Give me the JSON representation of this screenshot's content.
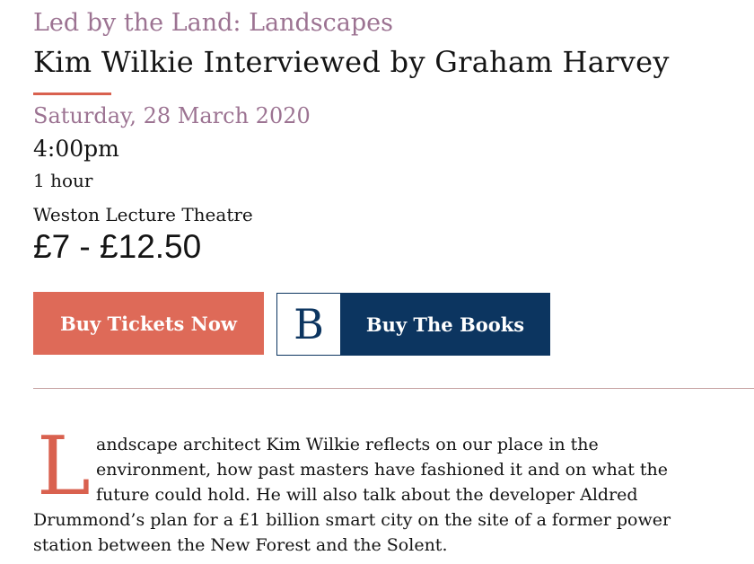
{
  "event": {
    "series": "Led by the Land: Landscapes",
    "title": "Kim Wilkie Interviewed by Graham Harvey",
    "date": "Saturday, 28 March 2020",
    "time": "4:00pm",
    "duration": "1 hour",
    "venue": "Weston Lecture Theatre",
    "price": "£7 - £12.50"
  },
  "buttons": {
    "tickets_label": "Buy Tickets Now",
    "books_logo": "B",
    "books_label": "Buy The Books"
  },
  "description": {
    "drop_cap": "L",
    "lines": [
      "andscape architect Kim Wilkie reflects on our place in the",
      "environment, how past masters have fashioned it and on what the",
      "future could hold. He will also talk about the developer Aldred",
      "Drummond’s plan for a £1 billion smart city on the site of a former power",
      "station between the New Forest and the Solent."
    ]
  },
  "colors": {
    "accent": "#d9614f",
    "series_text": "#9c7392",
    "books_button": "#0c3560",
    "tickets_button": "#de6a58"
  }
}
